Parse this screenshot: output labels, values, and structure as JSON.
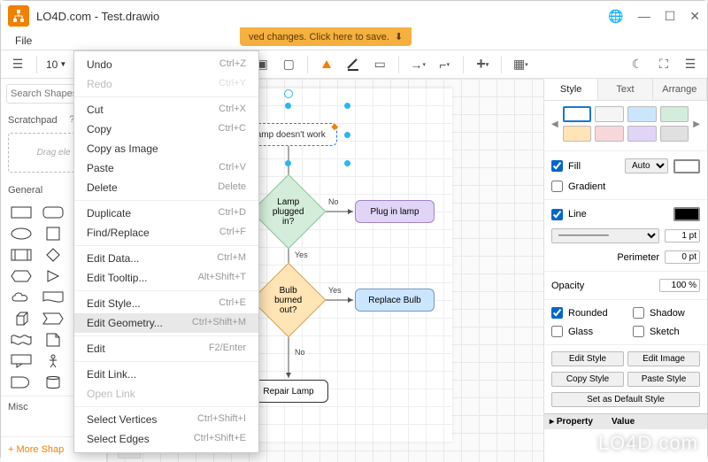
{
  "window": {
    "title": "LO4D.com - Test.drawio"
  },
  "menubar": {
    "file": "File"
  },
  "save_banner": "ved changes. Click here to save.",
  "toolbar": {
    "zoom": "10"
  },
  "left": {
    "search_placeholder": "Search Shapes",
    "scratchpad_title": "Scratchpad",
    "scratch_hint": "Drag ele",
    "general_title": "General",
    "misc_title": "Misc",
    "more_shapes": "+  More Shap"
  },
  "context_menu": [
    {
      "label": "Undo",
      "shortcut": "Ctrl+Z"
    },
    {
      "label": "Redo",
      "shortcut": "Ctrl+Y",
      "disabled": true
    },
    {
      "sep": true
    },
    {
      "label": "Cut",
      "shortcut": "Ctrl+X"
    },
    {
      "label": "Copy",
      "shortcut": "Ctrl+C"
    },
    {
      "label": "Copy as Image",
      "shortcut": ""
    },
    {
      "label": "Paste",
      "shortcut": "Ctrl+V"
    },
    {
      "label": "Delete",
      "shortcut": "Delete"
    },
    {
      "sep": true
    },
    {
      "label": "Duplicate",
      "shortcut": "Ctrl+D"
    },
    {
      "label": "Find/Replace",
      "shortcut": "Ctrl+F"
    },
    {
      "sep": true
    },
    {
      "label": "Edit Data...",
      "shortcut": "Ctrl+M"
    },
    {
      "label": "Edit Tooltip...",
      "shortcut": "Alt+Shift+T"
    },
    {
      "sep": true
    },
    {
      "label": "Edit Style...",
      "shortcut": "Ctrl+E"
    },
    {
      "label": "Edit Geometry...",
      "shortcut": "Ctrl+Shift+M",
      "hover": true
    },
    {
      "sep": true
    },
    {
      "label": "Edit",
      "shortcut": "F2/Enter"
    },
    {
      "sep": true
    },
    {
      "label": "Edit Link...",
      "shortcut": ""
    },
    {
      "label": "Open Link",
      "shortcut": "",
      "disabled": true
    },
    {
      "sep": true
    },
    {
      "label": "Select Vertices",
      "shortcut": "Ctrl+Shift+I"
    },
    {
      "label": "Select Edges",
      "shortcut": "Ctrl+Shift+E"
    }
  ],
  "flow": {
    "start": "Lamp doesn't work",
    "dec1": "Lamp plugged in?",
    "dec2": "Bulb burned out?",
    "plug": "Plug in lamp",
    "replace": "Replace Bulb",
    "repair": "Repair Lamp",
    "no": "No",
    "yes": "Yes"
  },
  "right": {
    "tabs": {
      "style": "Style",
      "text": "Text",
      "arrange": "Arrange"
    },
    "fill": "Fill",
    "fill_mode": "Auto",
    "gradient": "Gradient",
    "line": "Line",
    "line_width": "1 pt",
    "perimeter": "Perimeter",
    "perimeter_val": "0 pt",
    "opacity": "Opacity",
    "opacity_val": "100 %",
    "rounded": "Rounded",
    "shadow": "Shadow",
    "glass": "Glass",
    "sketch": "Sketch",
    "edit_style": "Edit Style",
    "edit_image": "Edit Image",
    "copy_style": "Copy Style",
    "paste_style": "Paste Style",
    "set_default": "Set as Default Style",
    "property": "Property",
    "value": "Value"
  },
  "palette_colors": {
    "row1": [
      "#ffffff",
      "#f5f5f5",
      "#cce5ff",
      "#d4edda"
    ],
    "row2": [
      "#ffe4b5",
      "#f8d7da",
      "#e0d4f7",
      "#e0e0e0"
    ]
  },
  "watermark": "LO4D.com"
}
